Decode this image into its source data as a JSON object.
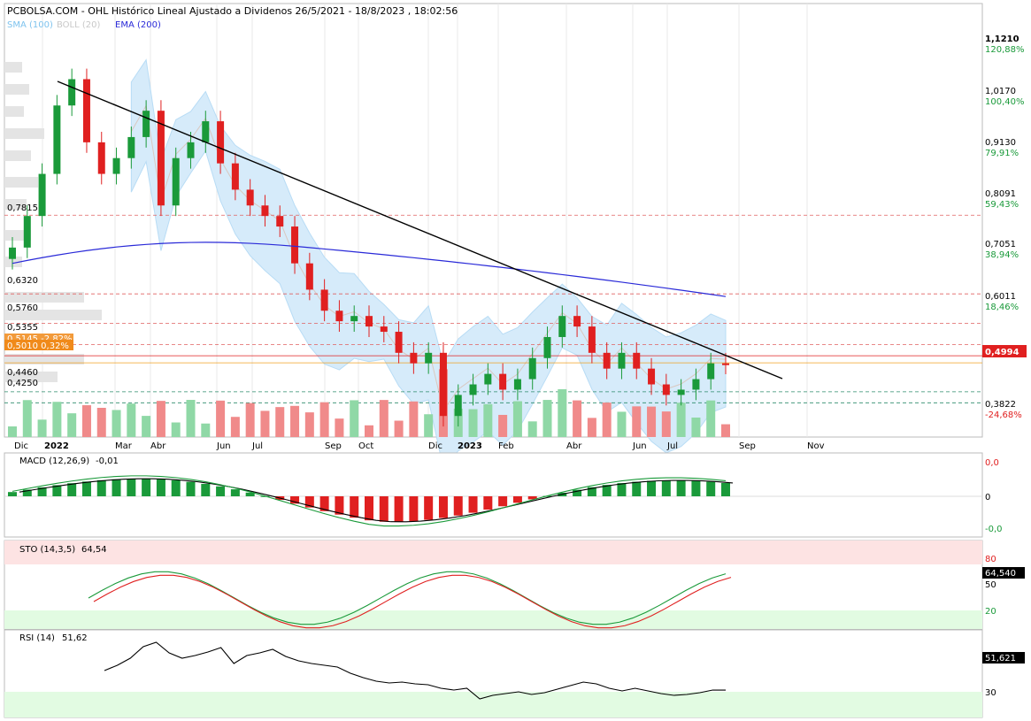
{
  "title": "PCBOLSA.COM - OHL Histórico Lineal Ajustado a Dividenos 26/5/2021 - 18/8/2023 , 18:02:56",
  "legend": [
    {
      "text": "SMA (100)",
      "color": "#7ec3ee"
    },
    {
      "text": "BOLL (20)",
      "color": "#cccccc"
    },
    {
      "text": "EMA (200)",
      "color": "#2a2ad8"
    }
  ],
  "price_scale": {
    "ticks": [
      {
        "price": "1,1210",
        "pct": "120,88%"
      },
      {
        "price": "1,0170",
        "pct": "100,40%"
      },
      {
        "price": "0,9130",
        "pct": "79,91%"
      },
      {
        "price": "0,8091",
        "pct": "59,43%"
      },
      {
        "price": "0,7051",
        "pct": "38,94%"
      },
      {
        "price": "0,6011",
        "pct": "18,46%"
      },
      {
        "price": "0,3822",
        "pct": "-24,68%"
      }
    ],
    "last_price": "0,4994"
  },
  "left_levels": [
    "0,7815",
    "0,6320",
    "0,5760",
    "0,5355",
    "0,4460",
    "0,4250"
  ],
  "current_tags": {
    "top": "0,5145 -2,82%",
    "bottom": "0,5010 0,32%"
  },
  "x_axis": [
    {
      "label": "Dic"
    },
    {
      "label": "2022"
    },
    {
      "label": "Mar"
    },
    {
      "label": "Abr"
    },
    {
      "label": "Jun"
    },
    {
      "label": "Jul"
    },
    {
      "label": "Sep"
    },
    {
      "label": "Oct"
    },
    {
      "label": "Dic"
    },
    {
      "label": "2023"
    },
    {
      "label": "Feb"
    },
    {
      "label": "Abr"
    },
    {
      "label": "Jun"
    },
    {
      "label": "Jul"
    },
    {
      "label": "Sep"
    },
    {
      "label": "Nov"
    }
  ],
  "macd": {
    "label": "MACD (12,26,9)",
    "value": "-0,01",
    "ticks": [
      "0,0",
      "0",
      "-0,0"
    ]
  },
  "sto": {
    "label": "STO (14,3,5)",
    "value": "64,54",
    "ticks": [
      "80",
      "50",
      "20"
    ],
    "last": "64,540"
  },
  "rsi": {
    "label": "RSI (14)",
    "value": "51,62",
    "ticks": [
      "30"
    ],
    "last": "51,621"
  },
  "colors": {
    "up": "#1a9a3a",
    "down": "#e02020",
    "ema": "#2a2ad8",
    "band": "#d6ebfa",
    "grid": "#e8e8e8"
  },
  "chart_data": {
    "type": "candlestick",
    "title": "PCBOLSA.COM - OHL Histórico Lineal Ajustado a Dividenos 26/5/2021 - 18/8/2023 , 18:02:56",
    "y_axis": {
      "ylim": [
        0.36,
        1.14
      ]
    },
    "approximate_closes": [
      0.72,
      0.78,
      0.86,
      0.99,
      1.04,
      0.92,
      0.86,
      0.89,
      0.93,
      0.98,
      0.8,
      0.89,
      0.92,
      0.96,
      0.88,
      0.83,
      0.8,
      0.78,
      0.76,
      0.69,
      0.64,
      0.6,
      0.58,
      0.59,
      0.57,
      0.56,
      0.52,
      0.5,
      0.52,
      0.4,
      0.44,
      0.46,
      0.48,
      0.45,
      0.47,
      0.51,
      0.55,
      0.59,
      0.57,
      0.52,
      0.49,
      0.52,
      0.49,
      0.46,
      0.44,
      0.45,
      0.47,
      0.5,
      0.4994
    ],
    "ema_200_start": 0.69,
    "ema_200_end": 0.627,
    "trendline": {
      "start": 1.03,
      "end": 0.44
    }
  }
}
